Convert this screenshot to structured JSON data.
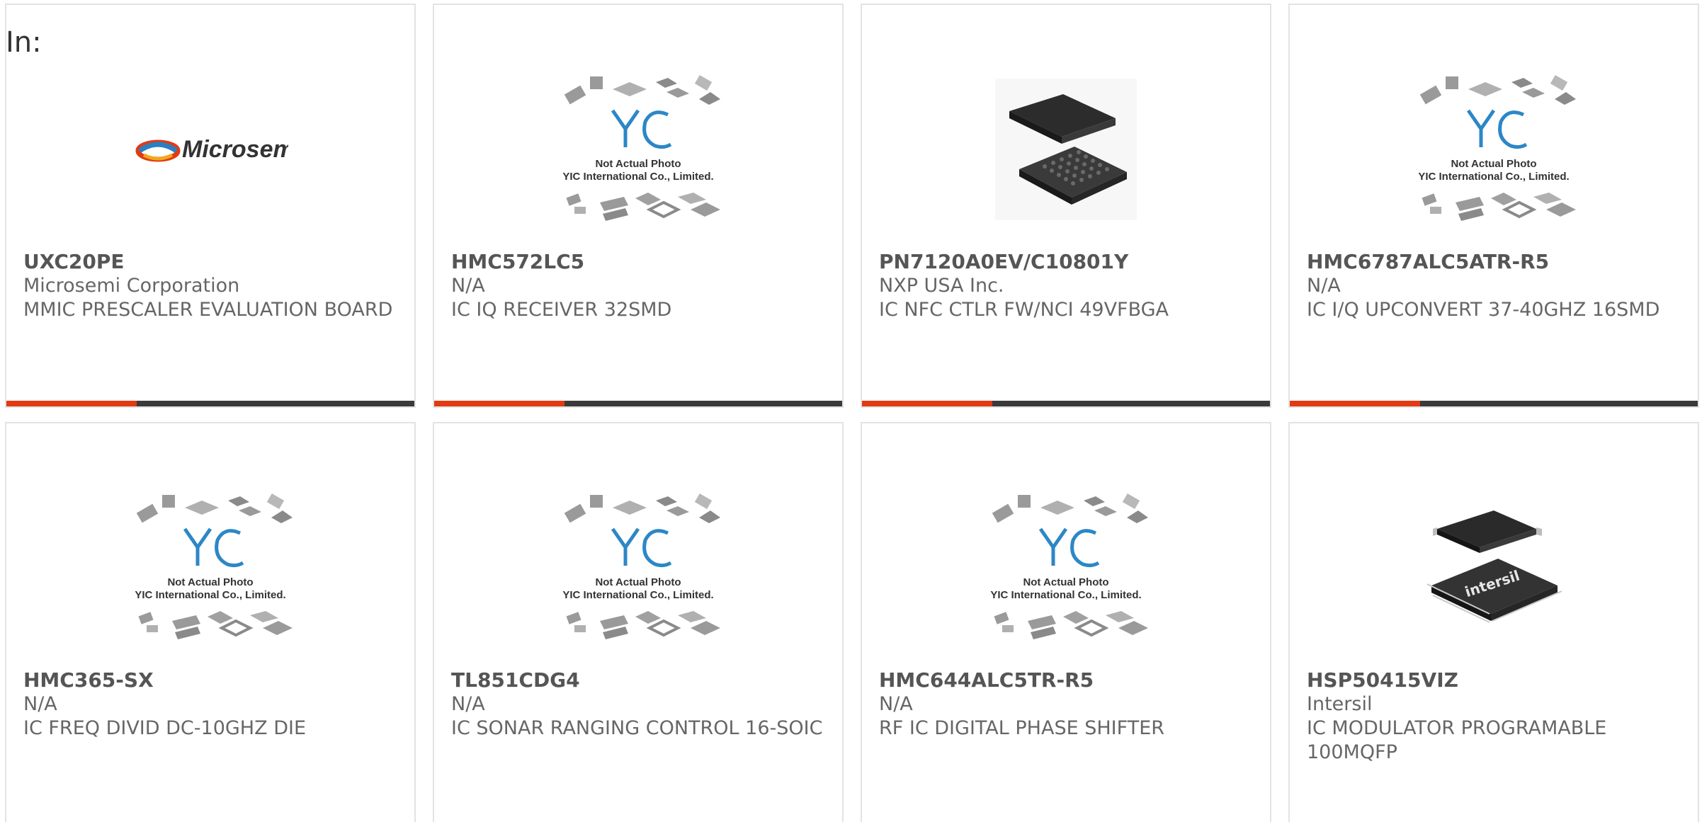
{
  "header": {
    "prefix": "In:"
  },
  "colors": {
    "accent": "#e23a12",
    "bar": "#3a3a3a",
    "border": "#e3e3e3",
    "text": "#666666"
  },
  "products": [
    {
      "part_number": "UXC20PE",
      "manufacturer": "Microsemi Corporation",
      "description": "MMIC PRESCALER EVALUATION BOARD",
      "image": "microsemi-logo",
      "logo_text": "Microsemi"
    },
    {
      "part_number": "HMC572LC5",
      "manufacturer": "N/A",
      "description": "IC IQ RECEIVER 32SMD",
      "image": "yic-placeholder",
      "placeholder_line1": "Not Actual Photo",
      "placeholder_line2": "YIC International Co., Limited."
    },
    {
      "part_number": "PN7120A0EV/C10801Y",
      "manufacturer": "NXP USA Inc.",
      "description": "IC NFC CTLR FW/NCI 49VFBGA",
      "image": "bga-chip-photo"
    },
    {
      "part_number": "HMC6787ALC5ATR-R5",
      "manufacturer": "N/A",
      "description": "IC I/Q UPCONVERT 37-40GHZ 16SMD",
      "image": "yic-placeholder",
      "placeholder_line1": "Not Actual Photo",
      "placeholder_line2": "YIC International Co., Limited."
    },
    {
      "part_number": "HMC365-SX",
      "manufacturer": "N/A",
      "description": "IC FREQ DIVID DC-10GHZ DIE",
      "image": "yic-placeholder",
      "placeholder_line1": "Not Actual Photo",
      "placeholder_line2": "YIC International Co., Limited."
    },
    {
      "part_number": "TL851CDG4",
      "manufacturer": "N/A",
      "description": "IC SONAR RANGING CONTROL 16-SOIC",
      "image": "yic-placeholder",
      "placeholder_line1": "Not Actual Photo",
      "placeholder_line2": "YIC International Co., Limited."
    },
    {
      "part_number": "HMC644ALC5TR-R5",
      "manufacturer": "N/A",
      "description": "RF IC DIGITAL PHASE SHIFTER",
      "image": "yic-placeholder",
      "placeholder_line1": "Not Actual Photo",
      "placeholder_line2": "YIC International Co., Limited."
    },
    {
      "part_number": "HSP50415VIZ",
      "manufacturer": "Intersil",
      "description": "IC MODULATOR PROGRAMABLE 100MQFP",
      "image": "qfp-chip-photo",
      "chip_marking": "intersil"
    }
  ]
}
